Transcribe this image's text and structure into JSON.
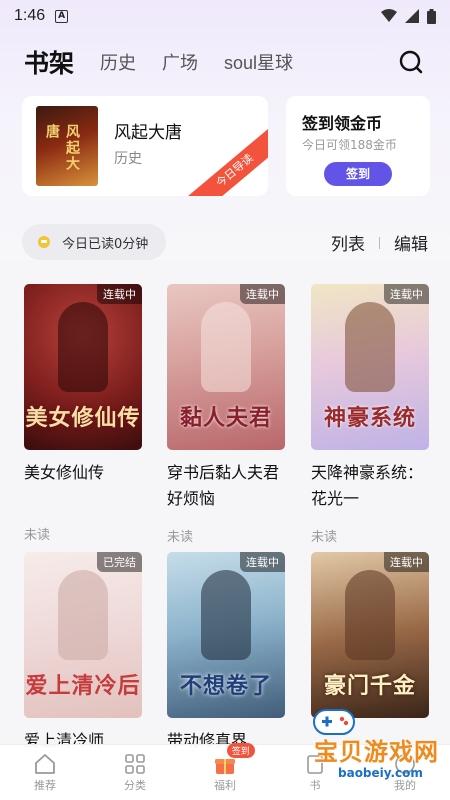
{
  "status_bar": {
    "time": "1:46",
    "notif_letter": "A"
  },
  "header": {
    "tabs": [
      {
        "label": "书架",
        "active": true
      },
      {
        "label": "历史",
        "active": false
      },
      {
        "label": "广场",
        "active": false
      },
      {
        "label": "soul星球",
        "active": false
      }
    ]
  },
  "recent": {
    "title": "风起大唐",
    "genre": "历史",
    "ribbon": "今日导读",
    "cover_text": "风起大唐"
  },
  "signin": {
    "title": "签到领金币",
    "subtitle": "今日可领188金币",
    "button": "签到"
  },
  "reading": {
    "text": "今日已读0分钟"
  },
  "view_actions": {
    "list": "列表",
    "edit": "编辑"
  },
  "books": [
    {
      "title": "美女修仙传",
      "status": "未读",
      "badge": "连载中",
      "cover_text": "美女修仙传"
    },
    {
      "title": "穿书后黏人夫君好烦恼",
      "status": "未读",
      "badge": "连载中",
      "cover_text": "黏人夫君"
    },
    {
      "title": "天降神豪系统：花光一",
      "status": "未读",
      "badge": "连载中",
      "cover_text": "神豪系统"
    },
    {
      "title": "爱上清冷师",
      "status": "",
      "badge": "已完结",
      "cover_text": "爱上清冷后"
    },
    {
      "title": "带动修真界",
      "status": "",
      "badge": "连载中",
      "cover_text": "不想卷了"
    },
    {
      "title": "",
      "status": "",
      "badge": "连载中",
      "cover_text": "豪门千金"
    }
  ],
  "nav": {
    "items": [
      {
        "label": "推荐",
        "icon": "home-icon"
      },
      {
        "label": "分类",
        "icon": "grid-icon"
      },
      {
        "label": "福利",
        "icon": "gift-icon",
        "badge": "签到"
      },
      {
        "label": "书",
        "icon": "book-icon"
      },
      {
        "label": "我的",
        "icon": "profile-icon"
      }
    ]
  },
  "watermark": {
    "text": "宝贝游戏网",
    "url": "baobeiy.com"
  },
  "colors": {
    "accent": "#6354e8",
    "ribbon": "#f3533d",
    "coin": "#f3c433"
  }
}
